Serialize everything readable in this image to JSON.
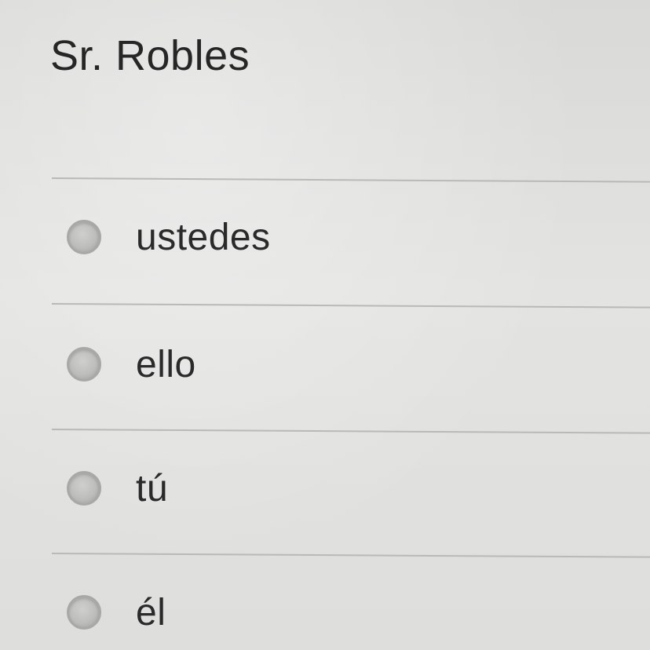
{
  "question": {
    "text": "Sr. Robles"
  },
  "options": [
    {
      "label": "ustedes"
    },
    {
      "label": "ello"
    },
    {
      "label": "tú"
    },
    {
      "label": "él"
    }
  ]
}
